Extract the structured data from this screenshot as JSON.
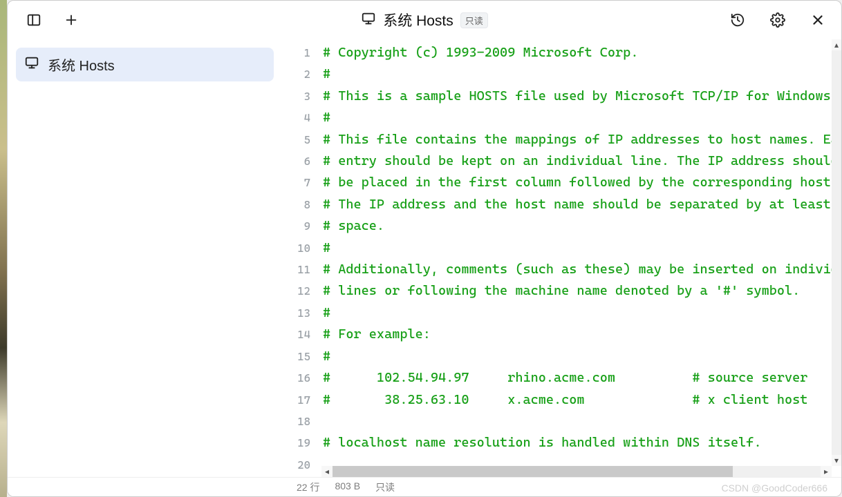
{
  "titlebar": {
    "title": "系统 Hosts",
    "readonly_badge": "只读"
  },
  "sidebar": {
    "items": [
      {
        "label": "系统 Hosts",
        "icon": "monitor-icon"
      }
    ]
  },
  "editor": {
    "lines": [
      "# Copyright (c) 1993-2009 Microsoft Corp.",
      "#",
      "# This is a sample HOSTS file used by Microsoft TCP/IP for Windows.",
      "#",
      "# This file contains the mappings of IP addresses to host names. Each",
      "# entry should be kept on an individual line. The IP address should",
      "# be placed in the first column followed by the corresponding host name.",
      "# The IP address and the host name should be separated by at least one",
      "# space.",
      "#",
      "# Additionally, comments (such as these) may be inserted on individual",
      "# lines or following the machine name denoted by a '#' symbol.",
      "#",
      "# For example:",
      "#",
      "#      102.54.94.97     rhino.acme.com          # source server",
      "#       38.25.63.10     x.acme.com              # x client host",
      "",
      "# localhost name resolution is handled within DNS itself.",
      ""
    ]
  },
  "statusbar": {
    "lines": "22 行",
    "size": "803 B",
    "mode": "只读"
  },
  "watermark": "CSDN @GoodCoder666"
}
